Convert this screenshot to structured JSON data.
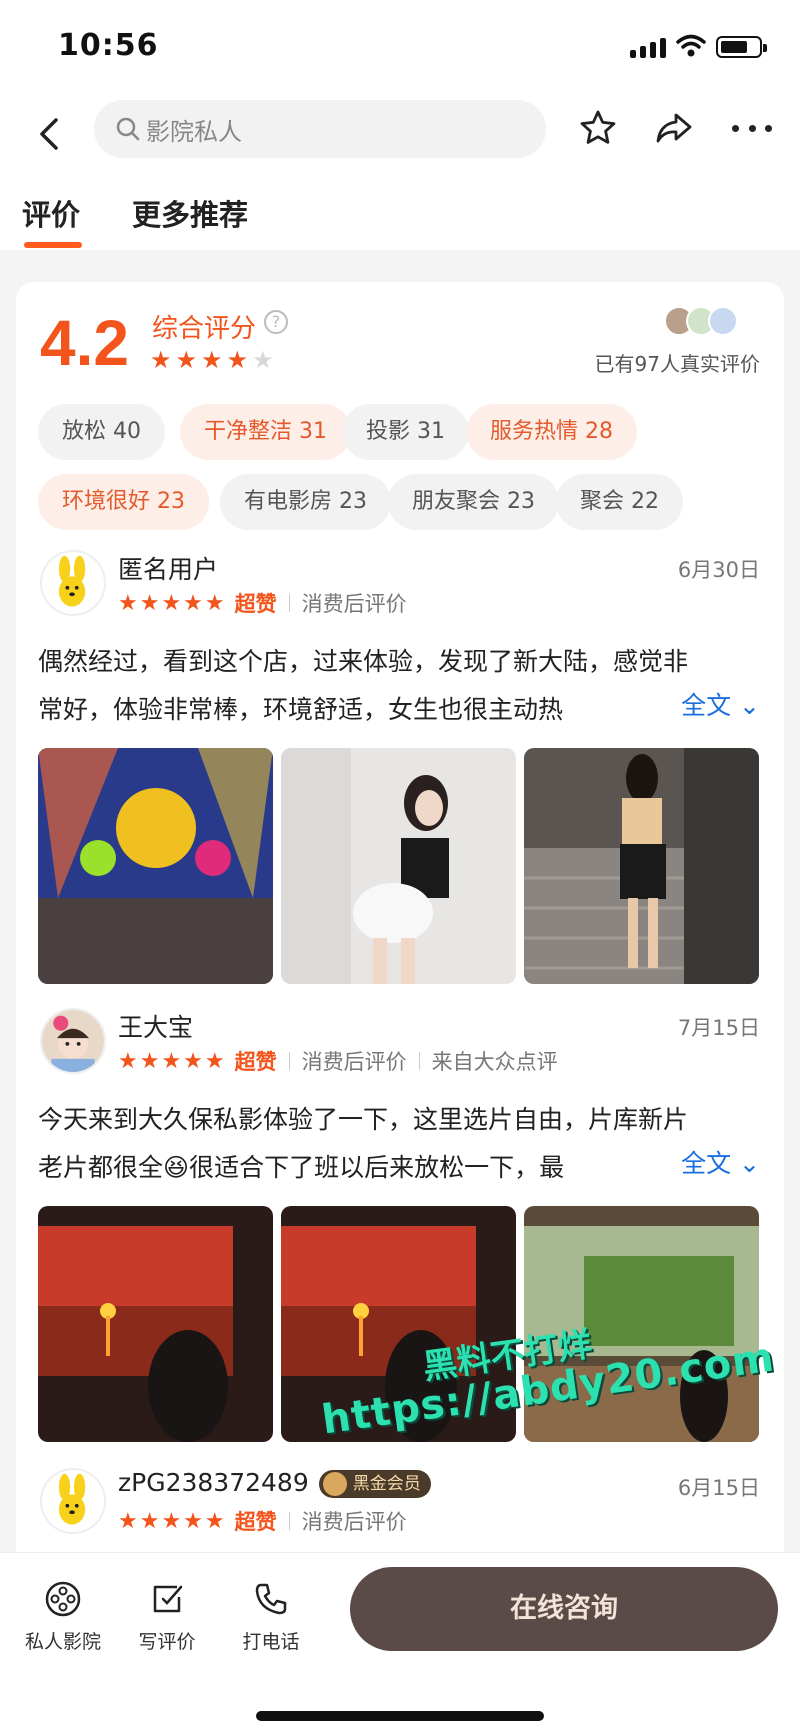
{
  "status_bar": {
    "time": "10:56"
  },
  "nav": {
    "search_placeholder": "影院私人"
  },
  "tabs": [
    {
      "label": "评价",
      "active": true
    },
    {
      "label": "更多推荐",
      "active": false
    }
  ],
  "summary": {
    "score": "4.2",
    "score_label": "综合评分",
    "stars_filled": 4,
    "stars_total": 5,
    "real_count": "已有97人真实评价"
  },
  "tags": [
    {
      "label": "放松 40",
      "hot": false
    },
    {
      "label": "干净整洁 31",
      "hot": true
    },
    {
      "label": "投影 31",
      "hot": false
    },
    {
      "label": "服务热情 28",
      "hot": true
    },
    {
      "label": "环境很好 23",
      "hot": true
    },
    {
      "label": "有电影房 23",
      "hot": false
    },
    {
      "label": "朋友聚会 23",
      "hot": false
    },
    {
      "label": "聚会 22",
      "hot": false
    }
  ],
  "reviews": [
    {
      "user": "匿名用户",
      "date": "6月30日",
      "rating_word": "超赞",
      "meta": "消费后评价",
      "source": "",
      "text": "偶然经过，看到这个店，过来体验，发现了新大陆，感觉非常好，体验非常棒，环境舒适，女生也很主动热",
      "more": "全文"
    },
    {
      "user": "王大宝",
      "date": "7月15日",
      "rating_word": "超赞",
      "meta": "消费后评价",
      "source": "来自大众点评",
      "text": "今天来到大久保私影体验了一下，这里选片自由，片库新片老片都很全😆很适合下了班以后来放松一下，最",
      "more": "全文"
    },
    {
      "user": "zPG238372489",
      "badge": "黑金会员",
      "date": "6月15日",
      "rating_word": "超赞",
      "meta": "消费后评价"
    }
  ],
  "watermark": {
    "line1": "黑料不打烊",
    "line2": "https://abdy20.com"
  },
  "bottom_bar": {
    "items": [
      {
        "label": "私人影院",
        "icon": "film-reel-icon"
      },
      {
        "label": "写评价",
        "icon": "edit-review-icon"
      },
      {
        "label": "打电话",
        "icon": "phone-icon"
      }
    ],
    "cta": "在线咨询"
  },
  "colors": {
    "accent": "#f2541b",
    "link": "#1a6fe0",
    "cta_bg": "#5a4a48"
  }
}
